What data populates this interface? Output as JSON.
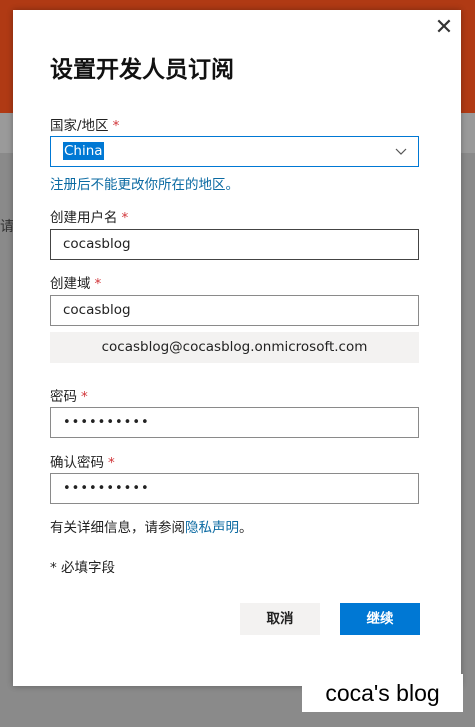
{
  "background": {
    "hint_char": "请"
  },
  "dialog": {
    "title": "设置开发人员订阅",
    "close_glyph": "✕",
    "country": {
      "label": "国家/地区",
      "required": "*",
      "selected": "China",
      "hint": "注册后不能更改你所在的地区。"
    },
    "username": {
      "label": "创建用户名",
      "required": "*",
      "value": "cocasblog"
    },
    "domain": {
      "label": "创建域",
      "required": "*",
      "value": "cocasblog",
      "full_address": "cocasblog@cocasblog.onmicrosoft.com"
    },
    "password": {
      "label": "密码",
      "required": "*",
      "value": "••••••••••"
    },
    "confirm_password": {
      "label": "确认密码",
      "required": "*",
      "value": "••••••••••"
    },
    "privacy": {
      "prefix": "有关详细信息，请参阅",
      "link": "隐私声明",
      "suffix": "。"
    },
    "required_note": "* 必填字段",
    "buttons": {
      "cancel": "取消",
      "continue": "继续"
    }
  },
  "watermark": "coca's blog",
  "colors": {
    "accent": "#0078d4",
    "link": "#0b6aa2",
    "required": "#d13438",
    "header_bg": "#b03a14"
  }
}
